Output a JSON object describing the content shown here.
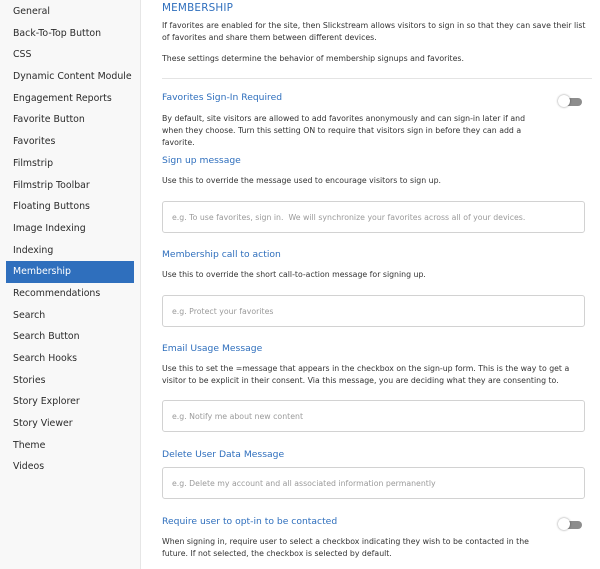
{
  "sidebar": {
    "items": [
      {
        "label": "General"
      },
      {
        "label": "Back-To-Top Button"
      },
      {
        "label": "CSS"
      },
      {
        "label": "Dynamic Content Module"
      },
      {
        "label": "Engagement Reports"
      },
      {
        "label": "Favorite Button"
      },
      {
        "label": "Favorites"
      },
      {
        "label": "Filmstrip"
      },
      {
        "label": "Filmstrip Toolbar"
      },
      {
        "label": "Floating Buttons"
      },
      {
        "label": "Image Indexing"
      },
      {
        "label": "Indexing"
      },
      {
        "label": "Membership"
      },
      {
        "label": "Recommendations"
      },
      {
        "label": "Search"
      },
      {
        "label": "Search Button"
      },
      {
        "label": "Search Hooks"
      },
      {
        "label": "Stories"
      },
      {
        "label": "Story Explorer"
      },
      {
        "label": "Story Viewer"
      },
      {
        "label": "Theme"
      },
      {
        "label": "Videos"
      }
    ],
    "active": "Membership"
  },
  "main": {
    "title": "MEMBERSHIP",
    "intro1": "If favorites are enabled for the site, then Slickstream allows visitors to sign in so that they can save their list of favorites and share them between different devices.",
    "intro2": "These settings determine the behavior of membership signups and favorites.",
    "favorites_signin": {
      "title": "Favorites Sign-In Required",
      "desc": "By default, site visitors are allowed to add favorites anonymously and can sign-in later if and when they choose. Turn this setting ON to require that visitors sign in before they can add a favorite.",
      "enabled": false
    },
    "signup_message": {
      "title": "Sign up message",
      "desc": "Use this to override the message used to encourage visitors to sign up.",
      "value": "",
      "placeholder": "e.g. To use favorites, sign in.  We will synchronize your favorites across all of your devices."
    },
    "call_to_action": {
      "title": "Membership call to action",
      "desc": "Use this to override the short call-to-action message for signing up.",
      "value": "",
      "placeholder": "e.g. Protect your favorites"
    },
    "email_usage": {
      "title": "Email Usage Message",
      "desc": "Use this to set the =message that appears in the checkbox on the sign-up form. This is the way to get a visitor to be explicit in their consent. Via this message, you are deciding what they are consenting to.",
      "value": "",
      "placeholder": "e.g. Notify me about new content"
    },
    "delete_data": {
      "title": "Delete User Data Message",
      "value": "",
      "placeholder": "e.g. Delete my account and all associated information permanently"
    },
    "opt_in": {
      "title": "Require user to opt-in to be contacted",
      "desc": "When signing in, require user to select a checkbox indicating they wish to be contacted in the future. If not selected, the checkbox is selected by default.",
      "enabled": false
    }
  },
  "colors": {
    "accent": "#2f6fbd",
    "sidebar_bg": "#f8f8f8",
    "toggle_off": "#8d8d8d"
  }
}
